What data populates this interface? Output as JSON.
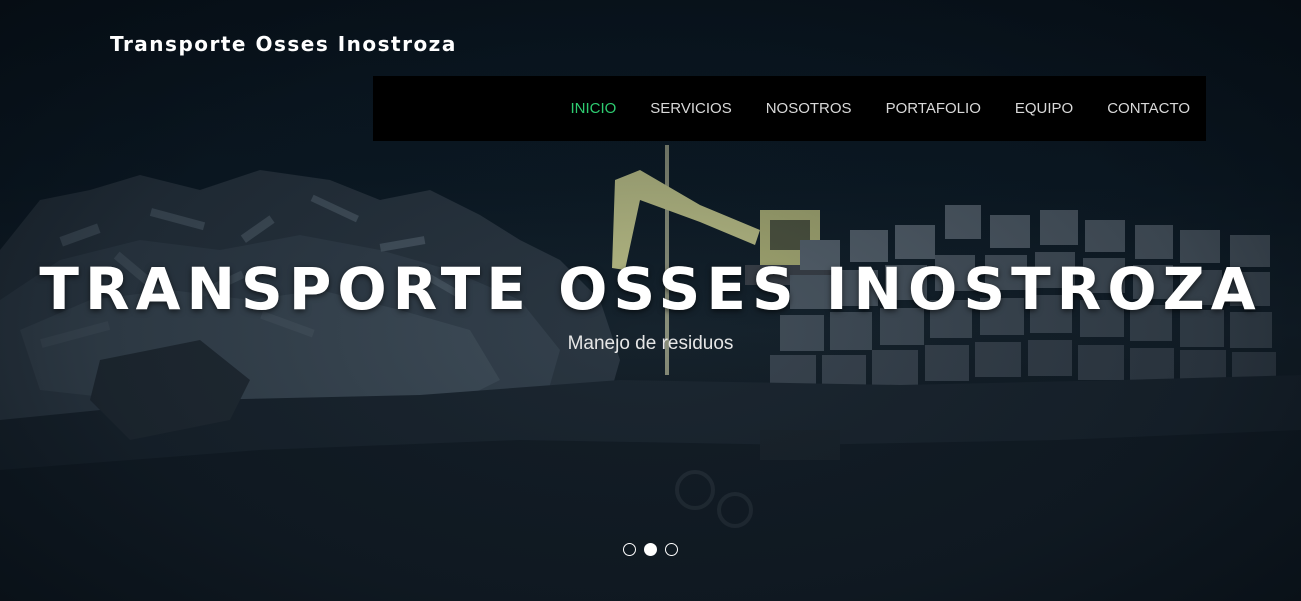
{
  "brand": {
    "title": "Transporte Osses Inostroza"
  },
  "nav": {
    "items": [
      {
        "label": "INICIO",
        "active": true
      },
      {
        "label": "SERVICIOS",
        "active": false
      },
      {
        "label": "NOSOTROS",
        "active": false
      },
      {
        "label": "PORTAFOLIO",
        "active": false
      },
      {
        "label": "EQUIPO",
        "active": false
      },
      {
        "label": "CONTACTO",
        "active": false
      }
    ],
    "active_color": "#2ecc71"
  },
  "hero": {
    "headline": "TRANSPORTE OSSES INOSTROZA",
    "subtitle": "Manejo de residuos"
  },
  "carousel": {
    "slide_count": 3,
    "active_index": 1
  }
}
